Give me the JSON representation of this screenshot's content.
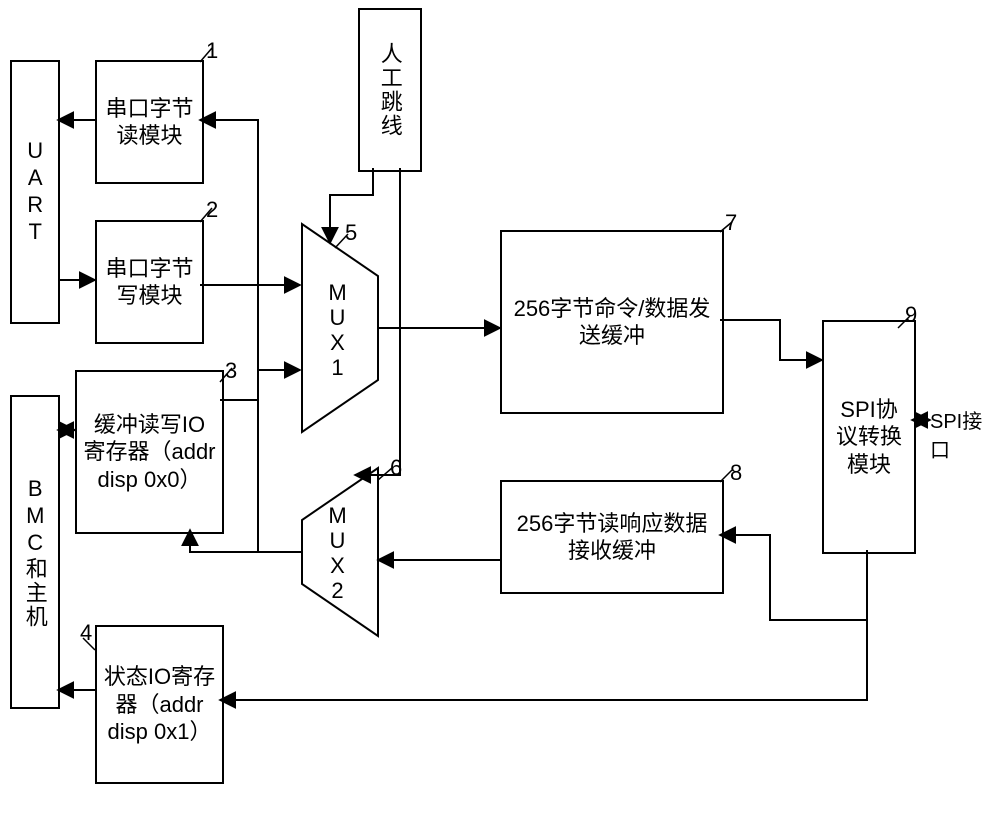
{
  "labels": {
    "uart": "UART",
    "uart_byte_read": "串口字节读模块",
    "uart_byte_write": "串口字节写模块",
    "buffer_rw_io_reg": "缓冲读写IO寄存器（addr disp 0x0）",
    "status_io_reg": "状态IO寄存器（addr disp 0x1）",
    "bmc_host": "BMC和主机",
    "manual_jumper": "人工跳线",
    "mux1": "MUX1",
    "mux2": "MUX2",
    "cmd_data_tx_buf": "256字节命令/数据发送缓冲",
    "read_resp_rx_buf": "256字节读响应数据接收缓冲",
    "spi_protocol_conv": "SPI协议转换模块",
    "spi_port": "SPI接口"
  },
  "numbers": {
    "n1": "1",
    "n2": "2",
    "n3": "3",
    "n4": "4",
    "n5": "5",
    "n6": "6",
    "n7": "7",
    "n8": "8",
    "n9": "9"
  }
}
